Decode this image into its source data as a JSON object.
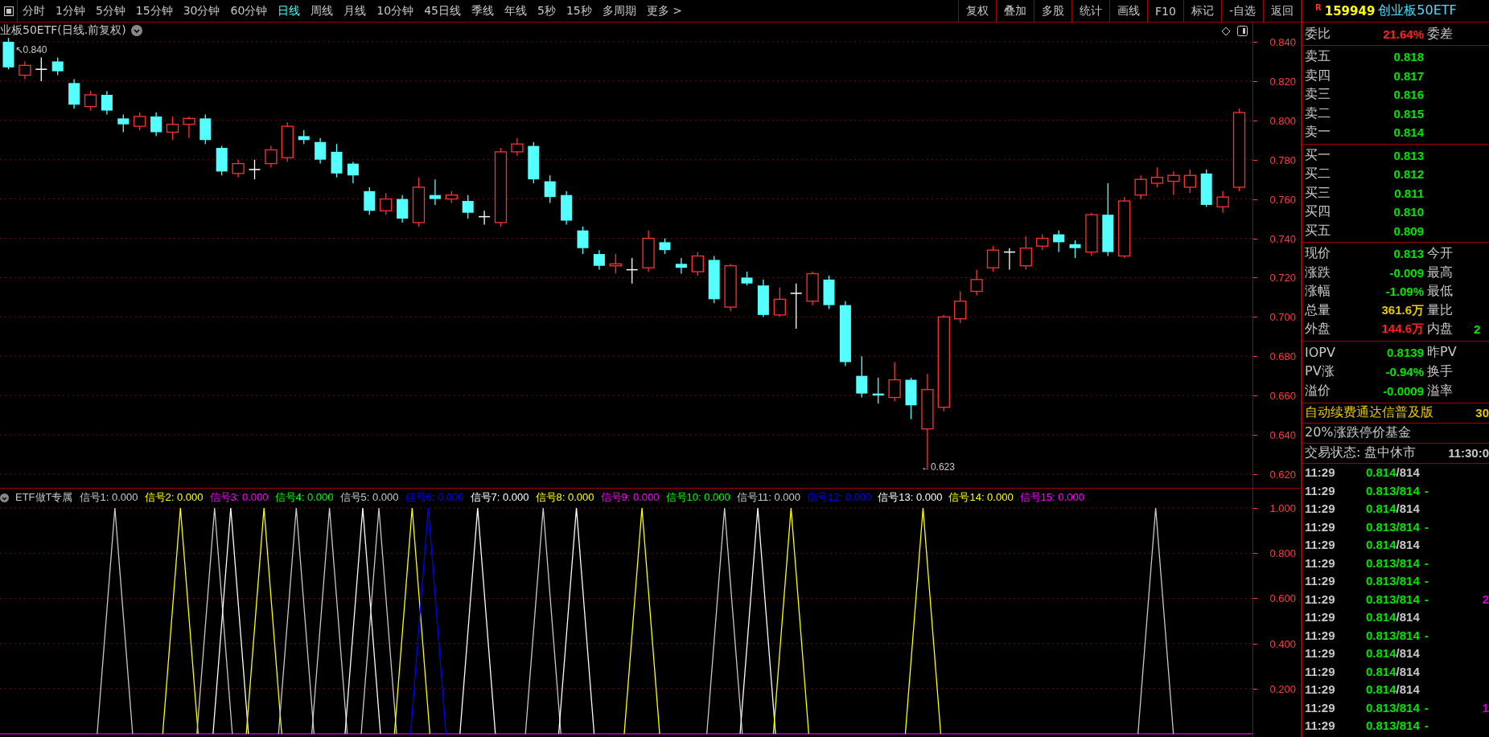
{
  "toolbar": {
    "periods": [
      {
        "label": "分时",
        "selected": false
      },
      {
        "label": "1分钟",
        "selected": false
      },
      {
        "label": "5分钟",
        "selected": false
      },
      {
        "label": "15分钟",
        "selected": false
      },
      {
        "label": "30分钟",
        "selected": false
      },
      {
        "label": "60分钟",
        "selected": false
      },
      {
        "label": "日线",
        "selected": true
      },
      {
        "label": "周线",
        "selected": false
      },
      {
        "label": "月线",
        "selected": false
      },
      {
        "label": "10分钟",
        "selected": false
      },
      {
        "label": "45日线",
        "selected": false
      },
      {
        "label": "季线",
        "selected": false
      },
      {
        "label": "年线",
        "selected": false
      },
      {
        "label": "5秒",
        "selected": false
      },
      {
        "label": "15秒",
        "selected": false
      },
      {
        "label": "多周期",
        "selected": false
      },
      {
        "label": "更多 >",
        "selected": false
      }
    ],
    "buttons": [
      "复权",
      "叠加",
      "多股",
      "统计",
      "画线",
      "F10",
      "标记",
      "-自选",
      "返回"
    ]
  },
  "chart": {
    "title": "业板50ETF(日线.前复权)",
    "price_axis": [
      "0.840",
      "0.820",
      "0.800",
      "0.780",
      "0.760",
      "0.740",
      "0.720",
      "0.700",
      "0.680",
      "0.660",
      "0.640",
      "0.620"
    ],
    "annotations": [
      {
        "text": "↖0.840",
        "kind": "high"
      },
      {
        "text": "←0.623",
        "kind": "low"
      }
    ]
  },
  "indicator": {
    "name": "ETF做T专属",
    "axis": [
      "1.000",
      "0.800",
      "0.600",
      "0.400",
      "0.200"
    ],
    "signals": [
      {
        "label": "信号1: 0.000",
        "color": "#c8c8c8"
      },
      {
        "label": "信号2: 0.000",
        "color": "#ffff00"
      },
      {
        "label": "信号3: 0.000",
        "color": "#ff00ff"
      },
      {
        "label": "信号4: 0.000",
        "color": "#00ff00"
      },
      {
        "label": "信号5: 0.000",
        "color": "#c8c8c8"
      },
      {
        "label": "信号6: 0.000",
        "color": "#0000ff"
      },
      {
        "label": "信号7: 0.000",
        "color": "#ffffff"
      },
      {
        "label": "信号8: 0.000",
        "color": "#ffff00"
      },
      {
        "label": "信号9: 0.000",
        "color": "#ff00ff"
      },
      {
        "label": "信号10: 0.000",
        "color": "#00ff00"
      },
      {
        "label": "信号11: 0.000",
        "color": "#c8c8c8"
      },
      {
        "label": "信号12: 0.000",
        "color": "#0000ff"
      },
      {
        "label": "信号13: 0.000",
        "color": "#ffffff"
      },
      {
        "label": "信号14: 0.000",
        "color": "#ffff00"
      },
      {
        "label": "信号15: 0.000",
        "color": "#ff00ff"
      }
    ]
  },
  "quote": {
    "badge": "R",
    "code": "159949",
    "name": "创业板50ETF",
    "ratio": {
      "label": "委比",
      "value": "21.64%",
      "color": "#ff2020",
      "label2": "委差"
    },
    "asks": [
      {
        "label": "卖五",
        "price": "0.818"
      },
      {
        "label": "卖四",
        "price": "0.817"
      },
      {
        "label": "卖三",
        "price": "0.816"
      },
      {
        "label": "卖二",
        "price": "0.815"
      },
      {
        "label": "卖一",
        "price": "0.814"
      }
    ],
    "bids": [
      {
        "label": "买一",
        "price": "0.813"
      },
      {
        "label": "买二",
        "price": "0.812"
      },
      {
        "label": "买三",
        "price": "0.811"
      },
      {
        "label": "买四",
        "price": "0.810"
      },
      {
        "label": "买五",
        "price": "0.809"
      }
    ],
    "stats": [
      {
        "label": "现价",
        "value": "0.813",
        "color": "#00e600",
        "label2": "今开"
      },
      {
        "label": "涨跌",
        "value": "-0.009",
        "color": "#00e600",
        "label2": "最高"
      },
      {
        "label": "涨幅",
        "value": "-1.09%",
        "color": "#00e600",
        "label2": "最低"
      },
      {
        "label": "总量",
        "value": "361.6万",
        "color": "#e6c800",
        "label2": "量比"
      },
      {
        "label": "外盘",
        "value": "144.6万",
        "color": "#ff2020",
        "label2": "内盘",
        "value2": "2"
      }
    ],
    "iopv": [
      {
        "label": "IOPV",
        "value": "0.8139",
        "color": "#00e600",
        "label2": "昨PV"
      },
      {
        "label": "PV涨",
        "value": "-0.94%",
        "color": "#00e600",
        "label2": "换手"
      },
      {
        "label": "溢价",
        "value": "-0.0009",
        "color": "#00e600",
        "label2": "溢率"
      }
    ],
    "notice": {
      "text": "自动续费通达信普及版",
      "value": "30"
    },
    "fund_type": "20%涨跌停价基金",
    "status": {
      "text": "交易状态: 盘中休市",
      "time": "11:30:0"
    },
    "ticks": [
      {
        "time": "11:29",
        "price": "0.814",
        "volume": "/814",
        "kind": "flat"
      },
      {
        "time": "11:29",
        "price": "0.813",
        "volume": "/814",
        "flag": "-",
        "kind": "down"
      },
      {
        "time": "11:29",
        "price": "0.814",
        "volume": "/814",
        "kind": "flat"
      },
      {
        "time": "11:29",
        "price": "0.813",
        "volume": "/814",
        "flag": "-",
        "kind": "down"
      },
      {
        "time": "11:29",
        "price": "0.814",
        "volume": "/814",
        "kind": "flat"
      },
      {
        "time": "11:29",
        "price": "0.813",
        "volume": "/814",
        "flag": "-",
        "kind": "down"
      },
      {
        "time": "11:29",
        "price": "0.813",
        "volume": "/814",
        "flag": "-",
        "kind": "down"
      },
      {
        "time": "11:29",
        "price": "0.813",
        "volume": "/814",
        "flag": "-",
        "kind": "down",
        "extra": "2"
      },
      {
        "time": "11:29",
        "price": "0.814",
        "volume": "/814",
        "kind": "flat"
      },
      {
        "time": "11:29",
        "price": "0.813",
        "volume": "/814",
        "flag": "-",
        "kind": "down"
      },
      {
        "time": "11:29",
        "price": "0.814",
        "volume": "/814",
        "kind": "flat"
      },
      {
        "time": "11:29",
        "price": "0.814",
        "volume": "/814",
        "kind": "flat"
      },
      {
        "time": "11:29",
        "price": "0.814",
        "volume": "/814",
        "kind": "flat"
      },
      {
        "time": "11:29",
        "price": "0.813",
        "volume": "/814",
        "flag": "-",
        "kind": "down",
        "extra": "1"
      },
      {
        "time": "11:29",
        "price": "0.813",
        "volume": "/814",
        "flag": "-",
        "kind": "down"
      }
    ]
  }
}
